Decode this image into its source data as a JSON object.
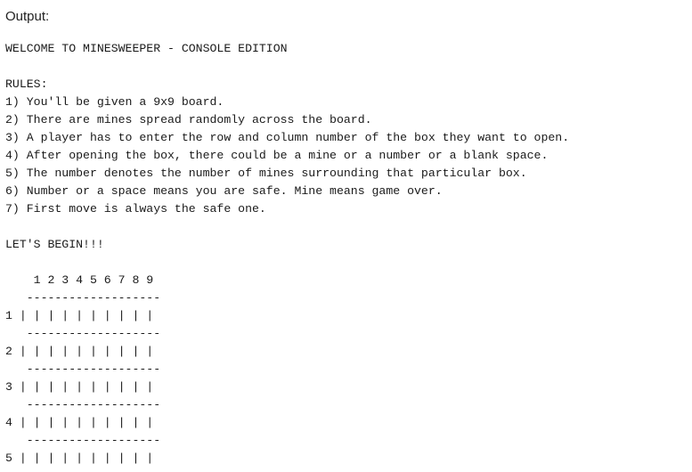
{
  "output_label": "Output:",
  "console": {
    "title": "WELCOME TO MINESWEEPER - CONSOLE EDITION",
    "rules_heading": "RULES:",
    "rules": [
      "1) You'll be given a 9x9 board.",
      "2) There are mines spread randomly across the board.",
      "3) A player has to enter the row and column number of the box they want to open.",
      "4) After opening the box, there could be a mine or a number or a blank space.",
      "5) The number denotes the number of mines surrounding that particular box.",
      "6) Number or a space means you are safe. Mine means game over.",
      "7) First move is always the safe one."
    ],
    "begin": "LET'S BEGIN!!!",
    "board": {
      "column_header": "    1 2 3 4 5 6 7 8 9",
      "separator": "   -------------------",
      "rows": [
        "1 | | | | | | | | | |",
        "2 | | | | | | | | | |",
        "3 | | | | | | | | | |",
        "4 | | | | | | | | | |",
        "5 | | | | | | | | | |"
      ]
    }
  }
}
